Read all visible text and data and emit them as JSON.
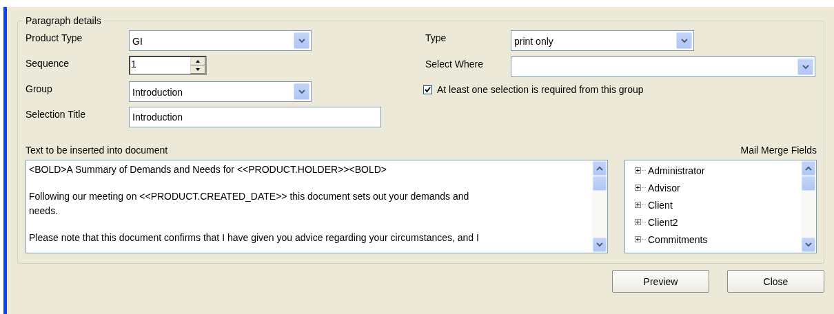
{
  "group_title": "Paragraph details",
  "left_fields": [
    {
      "kind": "combo",
      "label": "Product Type",
      "value": "GI"
    },
    {
      "kind": "spinner",
      "label": "Sequence",
      "value": "1"
    },
    {
      "kind": "combo",
      "label": "Group",
      "value": "Introduction"
    },
    {
      "kind": "text",
      "label": "Selection Title",
      "value": "Introduction"
    }
  ],
  "right_fields": [
    {
      "kind": "combo",
      "label": "Type",
      "value": "print only"
    },
    {
      "kind": "wide_combo",
      "label": "Select Where"
    }
  ],
  "required_checkbox": {
    "label": "At least one selection is required from this group",
    "checked": true
  },
  "document_text": {
    "label": "Text to be inserted into document",
    "paragraphs": [
      [
        "<BOLD>A Summary of Demands and Needs for <<PRODUCT.HOLDER>><BOLD>"
      ],
      [
        "Following our meeting on <<PRODUCT.CREATED_DATE>> this document sets out your demands and",
        "needs."
      ],
      [
        "Please note that this document confirms that I have given you advice regarding your circumstances, and I"
      ]
    ]
  },
  "mail_merge": {
    "label": "Mail Merge Fields",
    "items": [
      {
        "label": "Administrator",
        "expanded": false
      },
      {
        "label": "Advisor",
        "expanded": false
      },
      {
        "label": "Client",
        "expanded": false
      },
      {
        "label": "Client2",
        "expanded": false
      },
      {
        "label": "Commitments",
        "expanded": false
      }
    ]
  },
  "buttons": [
    "Preview",
    "Close"
  ]
}
